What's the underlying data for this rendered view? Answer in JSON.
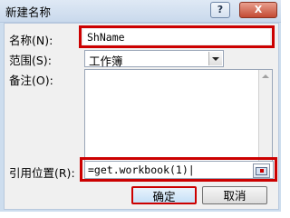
{
  "window": {
    "title": "新建名称",
    "help_label": "?",
    "close_label": "X"
  },
  "form": {
    "name_label": "名称(N):",
    "name_value": "ShName",
    "scope_label": "范围(S):",
    "scope_value": "工作簿",
    "comment_label": "备注(O):",
    "comment_value": "",
    "ref_label": "引用位置(R):",
    "ref_value": "=get.workbook(1)|"
  },
  "buttons": {
    "ok": "确定",
    "cancel": "取消"
  },
  "colors": {
    "highlight": "#cc0000"
  }
}
